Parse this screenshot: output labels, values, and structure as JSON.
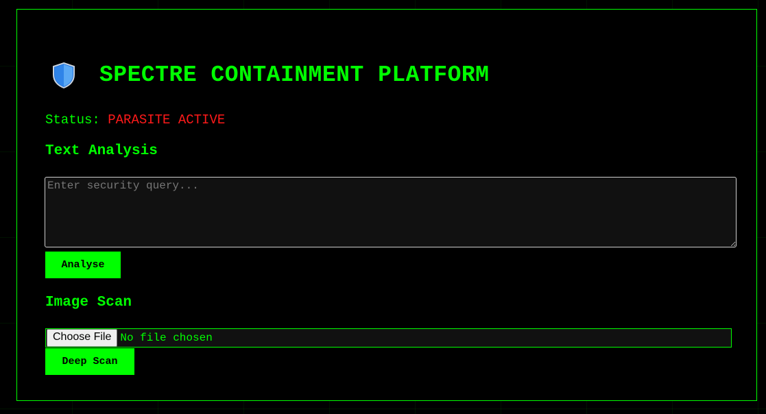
{
  "header": {
    "title": "SPECTRE CONTAINMENT PLATFORM",
    "icon": "shield-icon"
  },
  "status": {
    "label": "Status:",
    "value": "PARASITE ACTIVE"
  },
  "text_analysis": {
    "title": "Text Analysis",
    "placeholder": "Enter security query...",
    "button_label": "Analyse"
  },
  "image_scan": {
    "title": "Image Scan",
    "choose_label": "Choose File",
    "file_status": "No file chosen",
    "button_label": "Deep Scan"
  },
  "colors": {
    "accent": "#00ff00",
    "alert": "#ff1a1a",
    "background": "#000000",
    "field_bg": "#111111"
  }
}
